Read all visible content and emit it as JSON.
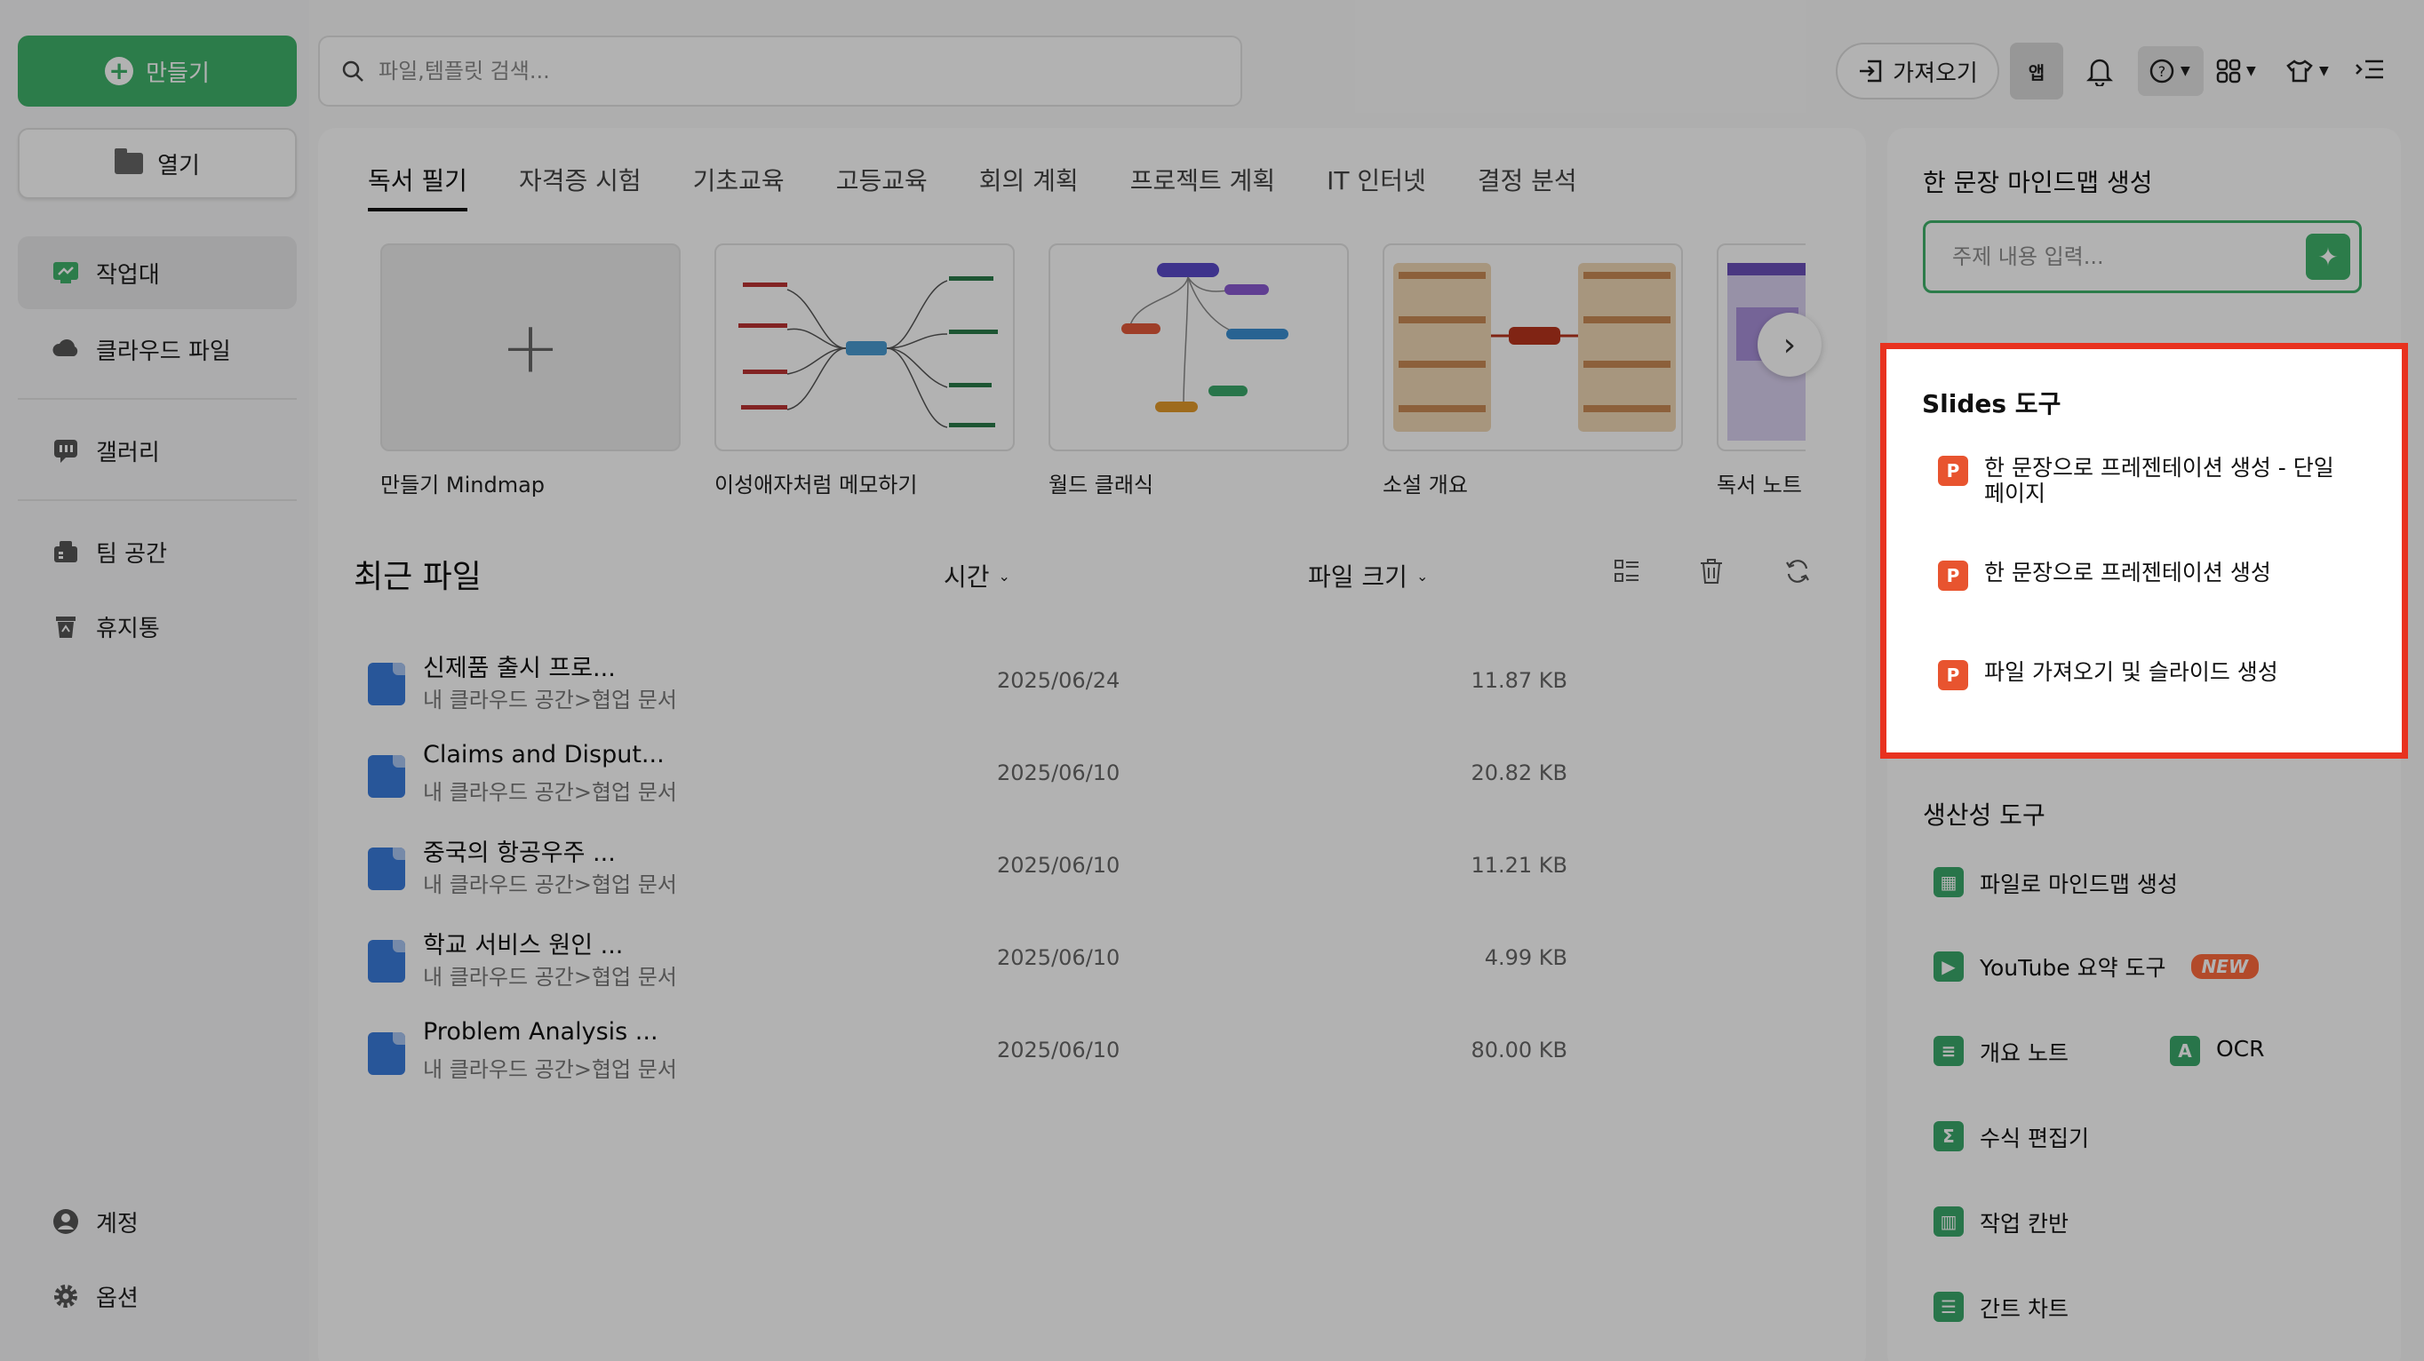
{
  "sidebar": {
    "create_label": "만들기",
    "open_label": "열기",
    "items": [
      {
        "label": "작업대",
        "icon": "workbench-icon"
      },
      {
        "label": "클라우드 파일",
        "icon": "cloud-icon"
      },
      {
        "label": "갤러리",
        "icon": "gallery-icon"
      },
      {
        "label": "팀 공간",
        "icon": "team-icon"
      },
      {
        "label": "휴지통",
        "icon": "trash-icon"
      }
    ],
    "bottom": [
      {
        "label": "계정",
        "icon": "account-icon"
      },
      {
        "label": "옵션",
        "icon": "gear-icon"
      }
    ]
  },
  "topbar": {
    "search_placeholder": "파일,템플릿 검색...",
    "import_label": "가져오기",
    "app_label": "앱"
  },
  "main": {
    "tabs": [
      "독서 필기",
      "자격증 시험",
      "기초교육",
      "고등교육",
      "회의 계획",
      "프로젝트 계획",
      "IT 인터넷",
      "결정 분석"
    ],
    "active_tab": 0,
    "templates": [
      {
        "label": "만들기 Mindmap"
      },
      {
        "label": "이성애자처럼 메모하기"
      },
      {
        "label": "월드 클래식"
      },
      {
        "label": "소설 개요"
      },
      {
        "label": "독서 노트 툴"
      }
    ],
    "recent_title": "최근 파일",
    "col_time": "시간",
    "col_size": "파일 크기",
    "files": [
      {
        "name": "신제품 출시 프로...",
        "path": "내 클라우드 공간>협업 문서",
        "date": "2025/06/24",
        "size": "11.87 KB"
      },
      {
        "name": "Claims and Disput...",
        "path": "내 클라우드 공간>협업 문서",
        "date": "2025/06/10",
        "size": "20.82 KB"
      },
      {
        "name": "중국의 항공우주 ...",
        "path": "내 클라우드 공간>협업 문서",
        "date": "2025/06/10",
        "size": "11.21 KB"
      },
      {
        "name": "학교 서비스 원인 ...",
        "path": "내 클라우드 공간>협업 문서",
        "date": "2025/06/10",
        "size": "4.99 KB"
      },
      {
        "name": "Problem Analysis ...",
        "path": "내 클라우드 공간>협업 문서",
        "date": "2025/06/10",
        "size": "80.00 KB"
      }
    ]
  },
  "right": {
    "mindmap_title": "한 문장 마인드맵 생성",
    "topic_placeholder": "주제 내용 입력...",
    "slides_title": "Slides 도구",
    "slides_tools": [
      {
        "line1": "한 문장으로 프레젠테이션 생성 - 단일",
        "line2": "페이지"
      },
      {
        "line1": "한 문장으로 프레젠테이션 생성",
        "line2": ""
      },
      {
        "line1": "파일 가져오기 및 슬라이드 생성",
        "line2": ""
      }
    ],
    "productivity_title": "생산성 도구",
    "productivity_tools": [
      {
        "label": "파일로 마인드맵 생성"
      },
      {
        "label": "YouTube 요약 도구",
        "badge": "NEW"
      },
      {
        "label": "개요 노트"
      },
      {
        "label": "OCR"
      },
      {
        "label": "수식 편집기"
      },
      {
        "label": "작업 칸반"
      },
      {
        "label": "간트 차트"
      }
    ]
  },
  "colors": {
    "accent": "#3fb26a",
    "highlight": "#e8321f",
    "ppt": "#e8542f",
    "file_icon": "#3a7bdc"
  }
}
